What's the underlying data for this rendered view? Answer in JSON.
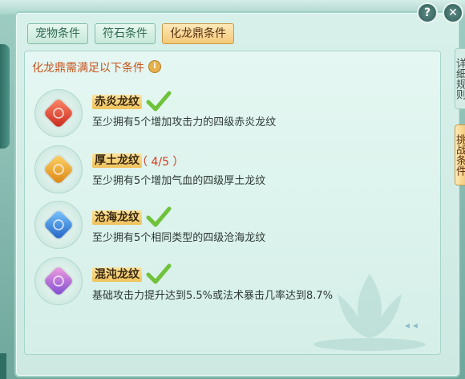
{
  "tabs": [
    {
      "label": "宠物条件",
      "active": false
    },
    {
      "label": "符石条件",
      "active": false
    },
    {
      "label": "化龙鼎条件",
      "active": true
    }
  ],
  "heading": "化龙鼎需满足以下条件",
  "heading_icon": "info-icon",
  "conditions": [
    {
      "title": "赤炎龙纹",
      "completed": true,
      "progress": "",
      "desc": "至少拥有5个增加攻击力的四级赤炎龙纹",
      "gem_color": "#e0402c",
      "icon": "red-dragon-gem-icon"
    },
    {
      "title": "厚土龙纹",
      "completed": false,
      "progress": "（ 4/5 ）",
      "desc": "至少拥有5个增加气血的四级厚土龙纹",
      "gem_color": "#e89a1e",
      "icon": "orange-dragon-gem-icon"
    },
    {
      "title": "沧海龙纹",
      "completed": true,
      "progress": "",
      "desc": "至少拥有5个相同类型的四级沧海龙纹",
      "gem_color": "#2f7fd6",
      "icon": "blue-dragon-gem-icon"
    },
    {
      "title": "混沌龙纹",
      "completed": true,
      "progress": "",
      "desc": "基础攻击力提升达到5.5%或法术暴击几率达到8.7%",
      "gem_color": "#9b5fd0",
      "icon": "purple-dragon-gem-icon"
    }
  ],
  "side_tabs": [
    {
      "label": "详细规则"
    },
    {
      "label": "挑战条件"
    }
  ],
  "buttons": {
    "help": "?",
    "close": "✕"
  },
  "colors": {
    "accent": "#f3c978",
    "check": "#6fc23a",
    "warning": "#d23a1e"
  }
}
